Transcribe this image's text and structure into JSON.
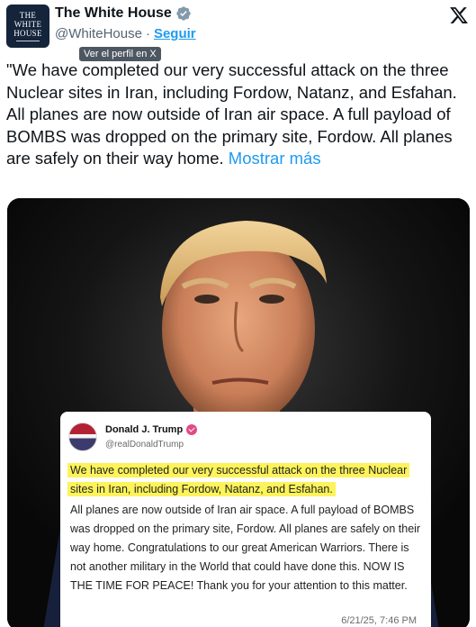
{
  "account": {
    "name": "The White House",
    "handle": "@WhiteHouse",
    "separator": "·",
    "follow_label": "Seguir",
    "avatar_lines": [
      "THE",
      "WHITE",
      "HOUSE"
    ]
  },
  "tooltip": "Ver el perfil en X",
  "tweet": {
    "text": "\"We have completed our very successful attack on the three Nuclear sites in Iran, including Fordow, Natanz, and Esfahan. All planes are now outside of Iran air space. A full payload of BOMBS was dropped on the primary site, Fordow. All planes are safely on their way home.",
    "show_more": "Mostrar más"
  },
  "embedded_post": {
    "name": "Donald J. Trump",
    "handle": "@realDonaldTrump",
    "highlighted_text": "We have completed our very successful attack on the three Nuclear sites in Iran, including Fordow, Natanz, and Esfahan.",
    "body_text": "All planes are now outside of Iran air space. A full payload of BOMBS was dropped on the primary site, Fordow. All planes are safely on their way home. Congratulations to our great American Warriors. There is not another military in the World that could have done this. NOW IS THE TIME FOR PEACE! Thank you for your attention to this matter.",
    "date": "6/21/25, 7:46 PM"
  },
  "colors": {
    "accent": "#1d9bf0",
    "verified_badge": "#829aab",
    "highlight": "#fdf35a",
    "card_badge": "#e2498a"
  },
  "icons": {
    "verified": "verified-badge-icon",
    "x_logo": "x-logo-icon",
    "card_verified": "verified-badge-icon"
  }
}
